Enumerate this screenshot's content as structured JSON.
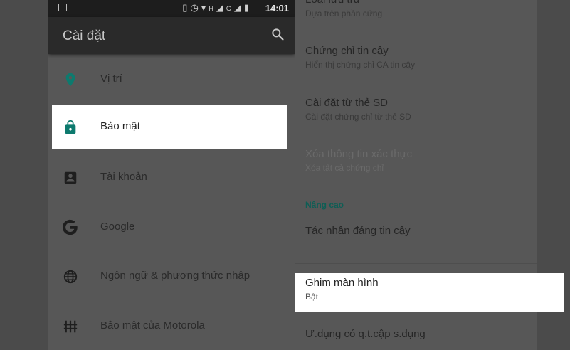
{
  "status_bar": {
    "time": "14:01",
    "network_labels": [
      "H",
      "G"
    ]
  },
  "left_screen": {
    "title": "Cài đặt",
    "items": [
      {
        "label": "Vị trí",
        "icon": "location-icon",
        "color": "#0d7a6e"
      },
      {
        "label": "Bảo mật",
        "icon": "lock-icon",
        "color": "#0d7a6e",
        "selected": true
      },
      {
        "label": "Tài khoản",
        "icon": "account-icon",
        "color": "#1e1e1e"
      },
      {
        "label": "Google",
        "icon": "google-icon",
        "color": "#1e1e1e"
      },
      {
        "label": "Ngôn ngữ & phương thức nhập",
        "icon": "globe-icon",
        "color": "#1e1e1e"
      },
      {
        "label": "Bảo mật của Motorola",
        "icon": "motorola-security-icon",
        "color": "#1e1e1e"
      }
    ]
  },
  "right_screen": {
    "top_partial": {
      "title": "Loại lưu trữ",
      "summary": "Dựa trên phần cứng"
    },
    "trusted_credentials": {
      "title": "Chứng chỉ tin cậy",
      "summary": "Hiển thị chứng chỉ CA tin cậy"
    },
    "install_from_sd": {
      "title": "Cài đặt từ thẻ SD",
      "summary": "Cài đặt chứng chỉ từ thẻ SD"
    },
    "clear_credentials": {
      "title": "Xóa thông tin xác thực",
      "summary": "Xóa tất cả chứng chỉ"
    },
    "advanced_section": "Nâng cao",
    "trust_agents": {
      "title": "Tác nhân đáng tin cậy"
    },
    "screen_pinning": {
      "title": "Ghim màn hình",
      "summary": "Bật"
    },
    "usage_access": {
      "title": "Ư.dụng có q.t.cập s.dụng"
    }
  },
  "colors": {
    "accent": "#0d7a6e",
    "section_header": "#0d5e55"
  }
}
